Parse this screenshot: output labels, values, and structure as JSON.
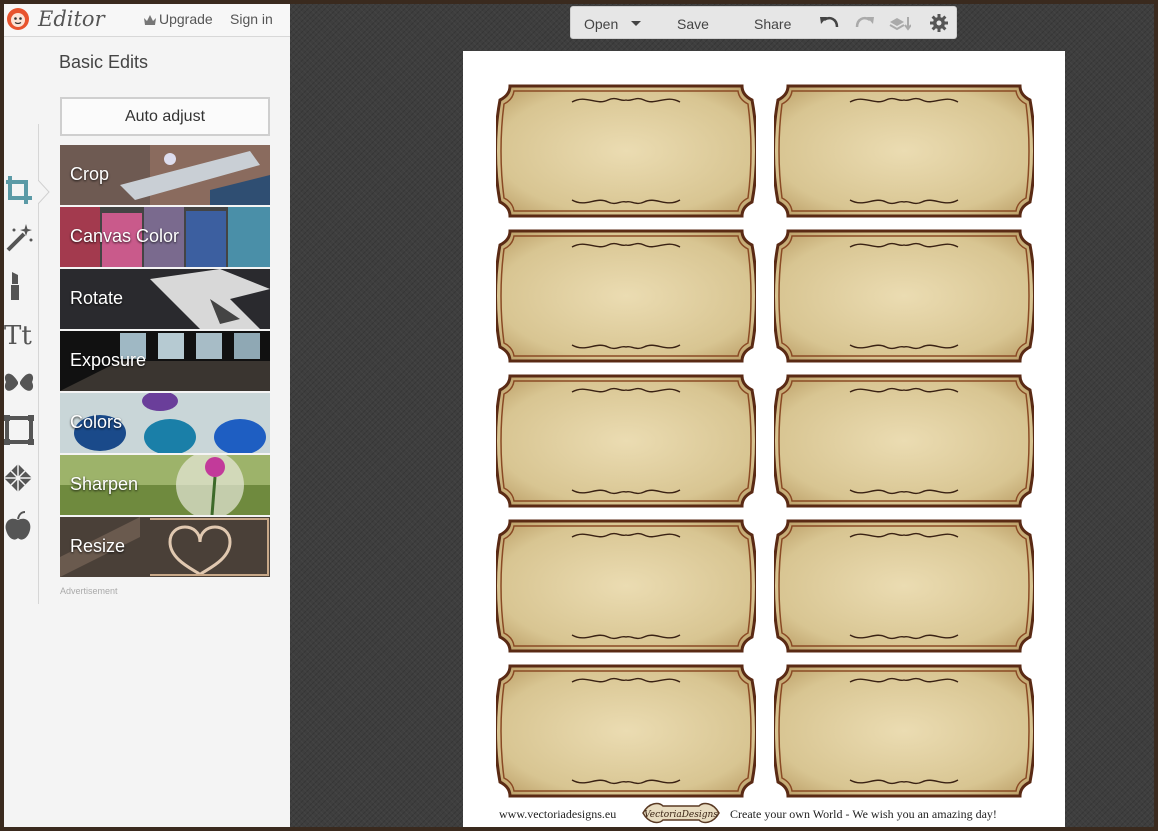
{
  "app": {
    "title": "Editor",
    "upgrade_label": "Upgrade",
    "signin_label": "Sign in"
  },
  "panel": {
    "title": "Basic Edits",
    "auto_adjust_label": "Auto adjust",
    "tools": [
      {
        "label": "Crop"
      },
      {
        "label": "Canvas Color"
      },
      {
        "label": "Rotate"
      },
      {
        "label": "Exposure"
      },
      {
        "label": "Colors"
      },
      {
        "label": "Sharpen"
      },
      {
        "label": "Resize"
      }
    ],
    "advert_label": "Advertisement"
  },
  "rail_icons": [
    "crop-icon",
    "magic-wand-icon",
    "lipstick-icon",
    "text-icon",
    "butterfly-icon",
    "frame-icon",
    "texture-icon",
    "apple-icon"
  ],
  "toolbar": {
    "open_label": "Open",
    "save_label": "Save",
    "share_label": "Share"
  },
  "document": {
    "footer_left": "www.vectoriadesigns.eu",
    "footer_logo": "VectoriaDesigns",
    "footer_right": "Create your own World - We wish you an amazing day!"
  },
  "colors": {
    "accent": "#5b9aa6",
    "label_paper": "#e3d4a8",
    "label_border": "#5a2a14"
  }
}
